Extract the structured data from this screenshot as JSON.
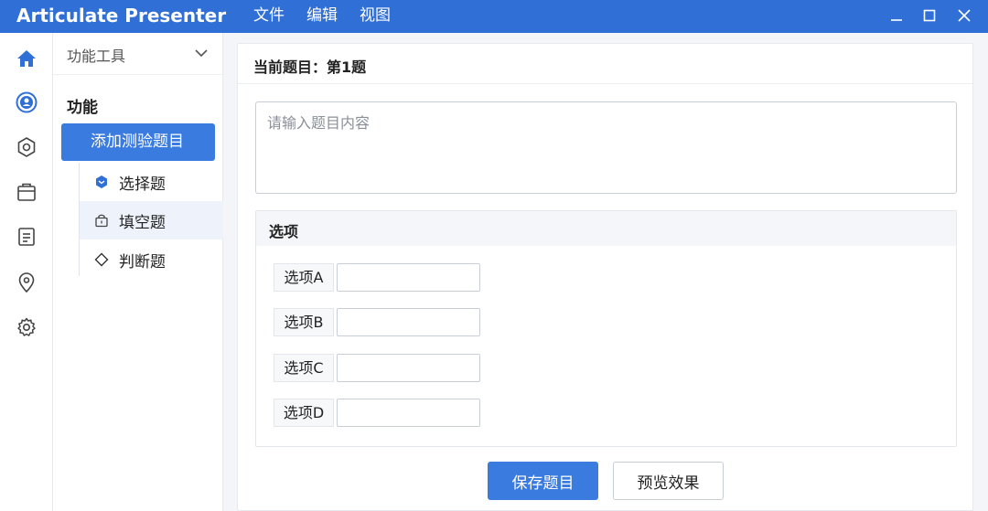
{
  "app": {
    "title": "Articulate Presenter"
  },
  "menu": {
    "items": [
      "文件",
      "编辑",
      "视图"
    ]
  },
  "window_controls": {
    "minimize_icon": "minimize-icon",
    "maximize_icon": "maximize-icon",
    "close_icon": "close-icon"
  },
  "rail": {
    "icons": [
      "home-icon",
      "user-circle-icon",
      "settings-gear-icon",
      "briefcase-icon",
      "document-icon",
      "location-pin-icon",
      "cog-icon"
    ],
    "accent": "#2f6fd6"
  },
  "panel": {
    "header_label": "功能工具",
    "section_label": "功能",
    "active_item": "添加测验题目",
    "sub_items": [
      {
        "label": "选择题",
        "icon": "hexagon-filled-icon"
      },
      {
        "label": "填空题",
        "icon": "lock-box-icon"
      },
      {
        "label": "判断题",
        "icon": "diamond-icon"
      }
    ]
  },
  "main": {
    "current_question": "当前题目：第1题",
    "question_placeholder": "请输入题目内容",
    "options_title": "选项",
    "options": [
      {
        "label": "选项A",
        "value": ""
      },
      {
        "label": "选项B",
        "value": ""
      },
      {
        "label": "选项C",
        "value": ""
      },
      {
        "label": "选项D",
        "value": ""
      }
    ],
    "save_label": "保存题目",
    "preview_label": "预览效果"
  },
  "colors": {
    "titlebar": "#2f6fd6",
    "primary": "#3a7be0"
  }
}
